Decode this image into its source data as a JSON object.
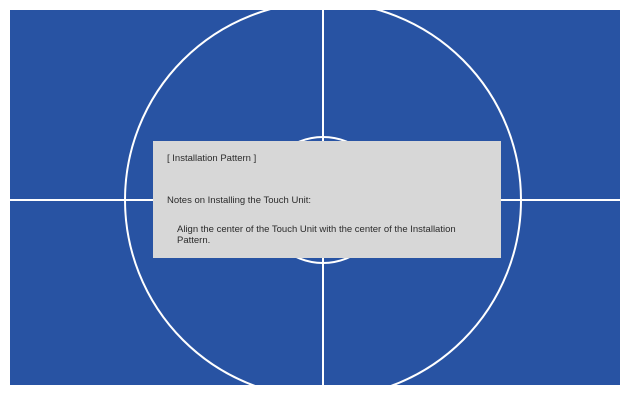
{
  "pattern": {
    "background_color": "#2853a3",
    "line_color": "#ffffff"
  },
  "notes": {
    "title": "[ Installation Pattern ]",
    "heading": "Notes on Installing the Touch Unit:",
    "body": "Align the center of the Touch Unit with the center of the Installation Pattern.",
    "background_color": "#d7d7d7"
  }
}
